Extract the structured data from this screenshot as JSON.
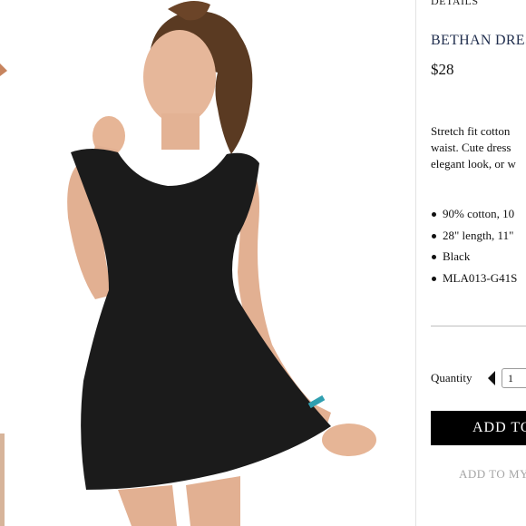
{
  "product": {
    "details_heading": "DETAILS",
    "title": "BETHAN DRES",
    "price": "$28",
    "description_lines": [
      "Stretch fit cotton",
      "waist. Cute dress",
      "elegant look, or w"
    ],
    "features": [
      "90% cotton, 10",
      "28\" length, 11\"",
      "Black",
      "MLA013-G41S"
    ]
  },
  "purchase": {
    "quantity_label": "Quantity",
    "quantity_value": "1",
    "add_to_bag_label": "ADD TO",
    "wishlist_label": "ADD TO MY"
  },
  "colors": {
    "title": "#1f2d4d",
    "button_bg": "#000000",
    "wishlist_text": "#a5a5a5"
  }
}
